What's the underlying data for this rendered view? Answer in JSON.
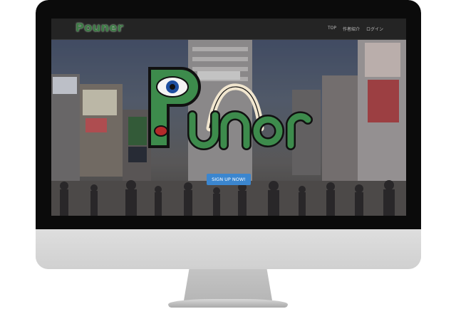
{
  "site": {
    "logo_text": "Pouner"
  },
  "nav": {
    "items": [
      {
        "label": "TOP"
      },
      {
        "label": "作者紹介"
      },
      {
        "label": "ログイン"
      }
    ]
  },
  "hero": {
    "cta_label": "SIGN UP NOW!",
    "logo_text": "Pouner"
  },
  "colors": {
    "logo_green": "#3f8a4f",
    "button_blue": "#3b86cf",
    "navbar": "#242424"
  }
}
